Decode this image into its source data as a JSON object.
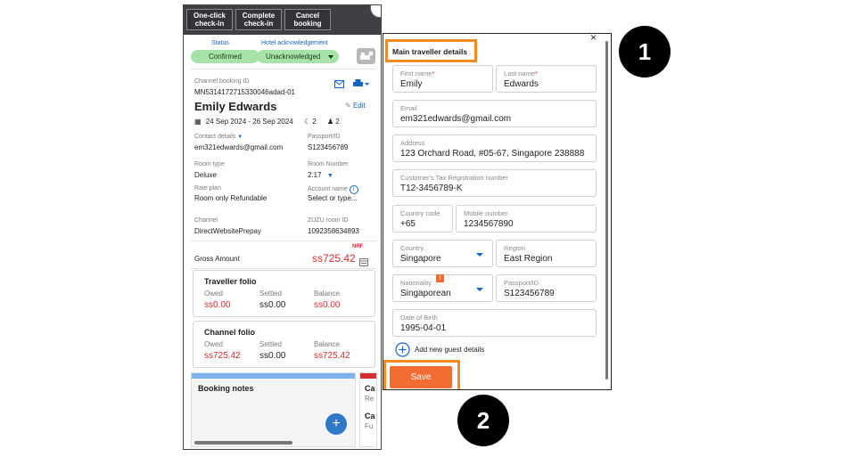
{
  "toolbar": {
    "buttons": [
      {
        "line1": "One-click",
        "line2": "check-in"
      },
      {
        "line1": "Complete",
        "line2": "check-in"
      },
      {
        "line1": "Cancel",
        "line2": "booking"
      }
    ]
  },
  "booking": {
    "status_label": "Status",
    "status_value": "Confirmed",
    "hotel_ack_label": "Hotel acknowledgement",
    "hotel_ack_value": "Unacknowledged",
    "channel_booking_id_label": "Channel booking ID",
    "channel_booking_id": "MN5314172715330046adad-01",
    "guest_name": "Emily Edwards",
    "edit_label": "Edit",
    "dates": "24 Sep 2024 - 26 Sep 2024",
    "nights": "2",
    "guests": "2",
    "contact_label": "Contact details",
    "contact_value": "em321edwards@gmail.com",
    "passport_label": "Passport/ID",
    "passport_value": "S123456789",
    "room_type_label": "Room type",
    "room_type_value": "Deluxe",
    "room_number_label": "Room Number",
    "room_number_value": "2.17",
    "rate_plan_label": "Rate plan",
    "rate_plan_value": "Room only Refundable",
    "account_name_label": "Account name",
    "account_name_value": "Select or type...",
    "channel_label": "Channel",
    "channel_value": "DirectWebsitePrepay",
    "zuzu_room_label": "ZUZU room ID",
    "zuzu_room_value": "1092358634893",
    "nrf": "NRF",
    "gross_label": "Gross Amount",
    "gross_value": "ss725.42",
    "traveller_folio": {
      "title": "Traveller folio",
      "headers": [
        "Owed",
        "Settled",
        "Balance"
      ],
      "values": [
        "ss0.00",
        "ss0.00",
        "ss0.00"
      ]
    },
    "channel_folio": {
      "title": "Channel folio",
      "headers": [
        "Owed",
        "Settled",
        "Balance"
      ],
      "values": [
        "ss725.42",
        "ss0.00",
        "ss725.42"
      ]
    },
    "booking_notes_title": "Booking notes",
    "add_label": "+",
    "clipped_1": "Ca",
    "clipped_2": "Re",
    "clipped_3": "Ca",
    "clipped_4": "Fu"
  },
  "traveller_form": {
    "close": "×",
    "title": "Main traveller details",
    "first_name_label": "First name",
    "first_name": "Emily",
    "last_name_label": "Last name",
    "last_name": "Edwards",
    "required_mark": "*",
    "email_label": "Email",
    "email": "em321edwards@gmail.com",
    "address_label": "Address",
    "address": "123 Orchard Road, #05-67, Singapore 238888",
    "tax_label": "Customer's Tax Registration number",
    "tax": "T12-3456789-K",
    "country_code_label": "Country code",
    "country_code": "+65",
    "mobile_label": "Mobile number",
    "mobile": "1234567890",
    "country_label": "Country",
    "country": "Singapore",
    "region_label": "Region",
    "region": "East Region",
    "nationality_label": "Nationality",
    "nationality_badge": "!",
    "nationality": "Singaporean",
    "passport_label": "Passport/ID",
    "passport": "S123456789",
    "dob_label": "Date of Birth",
    "dob": "1995-04-01",
    "add_guest_label": "Add new guest details",
    "save_label": "Save"
  },
  "callouts": [
    "1",
    "2"
  ],
  "colors": {
    "accent_orange": "#f08c22",
    "save_button": "#f36c31",
    "status_green": "#a7e3a9",
    "link_blue": "#1565c0",
    "amount_red": "#d32f2f"
  }
}
